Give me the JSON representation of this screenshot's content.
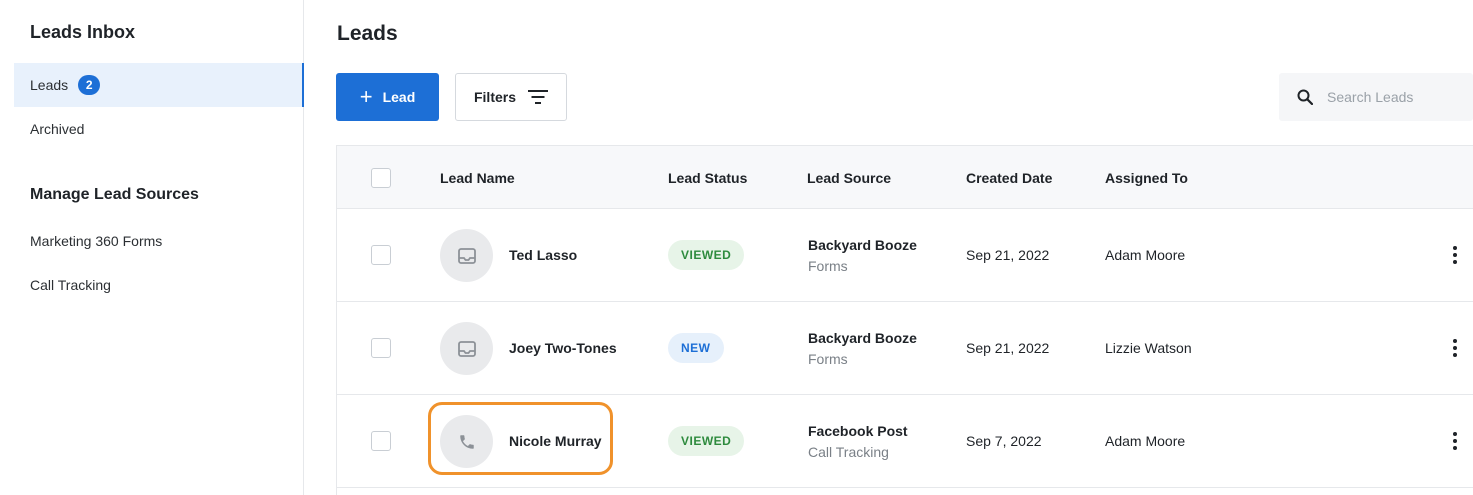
{
  "sidebar": {
    "title": "Leads Inbox",
    "items": [
      {
        "label": "Leads",
        "badge": "2"
      },
      {
        "label": "Archived"
      }
    ],
    "section_title": "Manage Lead Sources",
    "sources": [
      {
        "label": "Marketing 360 Forms"
      },
      {
        "label": "Call Tracking"
      }
    ]
  },
  "main": {
    "title": "Leads",
    "add_button_label": "Lead",
    "filters_label": "Filters",
    "search_placeholder": "Search Leads"
  },
  "table": {
    "headers": [
      "Lead Name",
      "Lead Status",
      "Lead Source",
      "Created Date",
      "Assigned To"
    ],
    "rows": [
      {
        "icon": "inbox-icon",
        "name": "Ted Lasso",
        "status": "VIEWED",
        "status_type": "viewed",
        "source": "Backyard Booze",
        "source_type": "Forms",
        "created": "Sep 21, 2022",
        "assigned": "Adam Moore"
      },
      {
        "icon": "inbox-icon",
        "name": "Joey Two-Tones",
        "status": "NEW",
        "status_type": "new",
        "source": "Backyard Booze",
        "source_type": "Forms",
        "created": "Sep 21, 2022",
        "assigned": "Lizzie Watson"
      },
      {
        "icon": "phone-icon",
        "name": "Nicole Murray",
        "status": "VIEWED",
        "status_type": "viewed",
        "source": "Facebook Post",
        "source_type": "Call Tracking",
        "created": "Sep 7, 2022",
        "assigned": "Adam Moore"
      }
    ]
  },
  "colors": {
    "accent": "#1d6fd6",
    "highlight": "#f0922b",
    "viewed": "#2e8b3e"
  }
}
